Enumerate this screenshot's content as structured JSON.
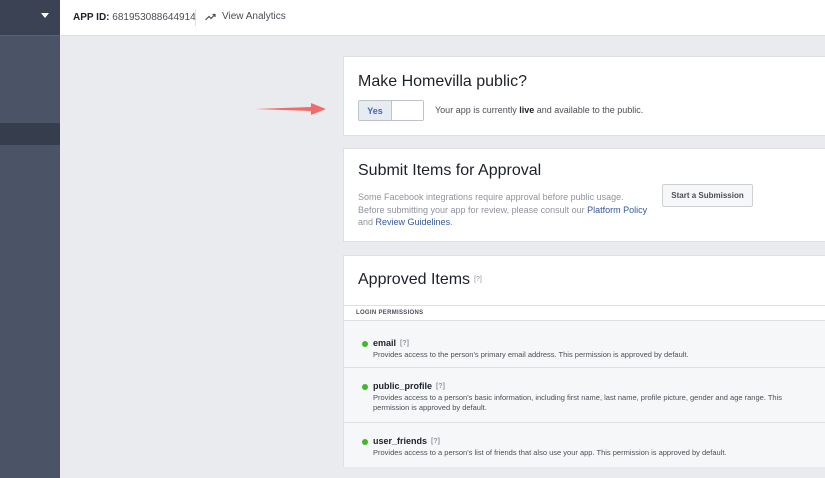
{
  "topbar": {
    "app_id_label": "APP ID:",
    "app_id_value": "681953088644914",
    "analytics_label": "View Analytics"
  },
  "public_card": {
    "title": "Make Homevilla public?",
    "toggle_yes": "Yes",
    "status_prefix": "Your app is currently ",
    "status_bold": "live",
    "status_suffix": " and available to the public."
  },
  "submit_card": {
    "title": "Submit Items for Approval",
    "desc_part1": "Some Facebook integrations require approval before public usage. Before submitting your app for review, please consult our ",
    "link_platform_policy": "Platform Policy",
    "desc_part2": " and ",
    "link_review_guidelines": "Review Guidelines",
    "desc_part3": ".",
    "button_label": "Start a Submission"
  },
  "approved_card": {
    "title": "Approved Items",
    "help_marker": "[?]",
    "section_label": "LOGIN PERMISSIONS",
    "permissions": [
      {
        "name": "email",
        "help": "[?]",
        "description": "Provides access to the person's primary email address. This permission is approved by default."
      },
      {
        "name": "public_profile",
        "help": "[?]",
        "description": "Provides access to a person's basic information, including first name, last name, profile picture, gender and age range. This permission is approved by default."
      },
      {
        "name": "user_friends",
        "help": "[?]",
        "description": "Provides access to a person's list of friends that also use your app. This permission is approved by default."
      }
    ]
  },
  "colors": {
    "sidebar": "#4b5366",
    "accent": "#4267b2",
    "status_green": "#42b72a",
    "arrow": "#f26b6b"
  },
  "icons": {
    "sidebar_caret": "chevron-down-icon",
    "analytics": "trend-up-icon",
    "annotation": "arrow-right-icon",
    "permission_status": "green-dot-icon"
  }
}
